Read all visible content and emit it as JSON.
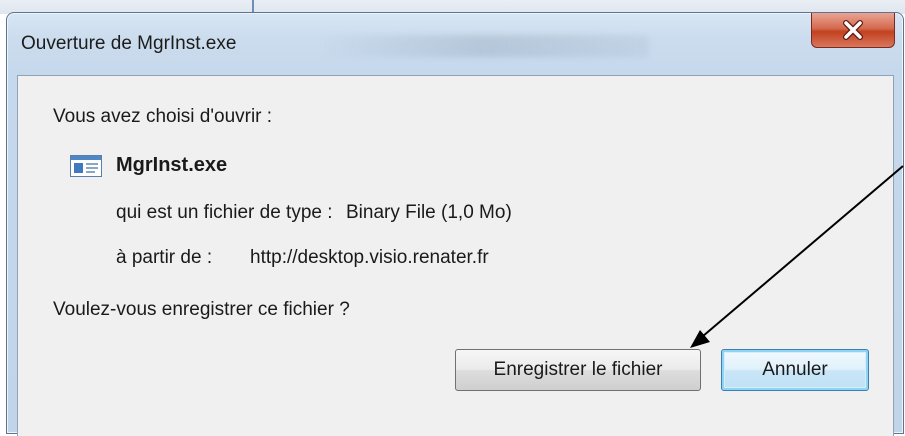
{
  "window": {
    "title": "Ouverture de MgrInst.exe",
    "close_glyph": "close-icon"
  },
  "dialog": {
    "intro": "Vous avez choisi d'ouvrir :",
    "file_icon": "application-window-icon",
    "file_name": "MgrInst.exe",
    "type_label": "qui est un fichier de type :",
    "type_value": "Binary File (1,0 Mo)",
    "from_label": "à partir de :",
    "from_value": "http://desktop.visio.renater.fr",
    "question": "Voulez-vous enregistrer ce fichier ?"
  },
  "buttons": {
    "save_label": "Enregistrer le fichier",
    "cancel_label": "Annuler"
  },
  "colors": {
    "close_button": "#c2411f",
    "title_bar": "#cbdcee",
    "content_bg": "#f0f0f0",
    "default_button_border": "#3c7fb1"
  },
  "annotation": {
    "arrow_icon": "arrow-annotation-icon"
  }
}
